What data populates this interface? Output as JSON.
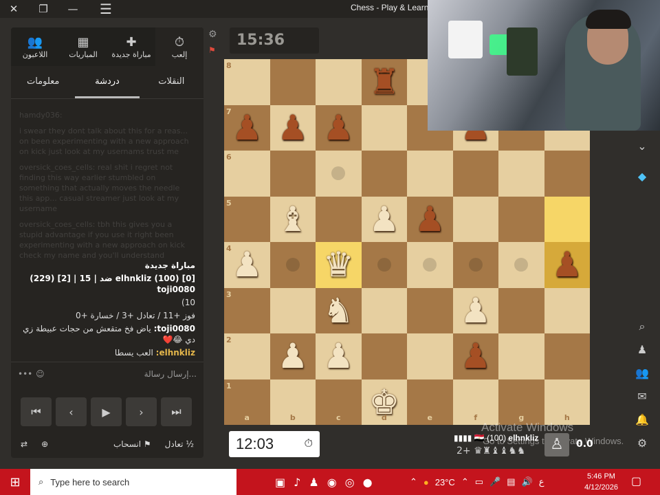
{
  "window": {
    "title": "Chess - Play & Learn -",
    "close": "✕",
    "restore": "❐",
    "minimize": "—",
    "menu": "☰"
  },
  "top_nav": [
    {
      "label": "اللاعبون",
      "icon": "players-icon",
      "glyph": "👥"
    },
    {
      "label": "المباريات",
      "icon": "games-icon",
      "glyph": "▦"
    },
    {
      "label": "مباراة جديدة",
      "icon": "new-game-icon",
      "glyph": "✚"
    },
    {
      "label": "إلعب",
      "icon": "play-clock-icon",
      "glyph": "⏱"
    }
  ],
  "tabs": [
    {
      "label": "معلومات"
    },
    {
      "label": "دردشة"
    },
    {
      "label": "النقلات"
    }
  ],
  "chat": {
    "faded": [
      "hamdy036:",
      "i swear they dont talk about this for a reas... on been experimenting with a new approach on kick just look at my usernams trust me",
      "oversick_coes_cells: real shit i regret not finding this way earlier stumbled on something that actually moves the needle this app... casual streamer just look at my username",
      "oversick_coes_cells: tbh this gives you a stupid advantage if you use it right been experimenting with a new approach on kick check my name and you'll understand"
    ],
    "new_game_title": "مباراة جديدة",
    "match_line": "[0] (100) elhnkliz ضد | 15 | [2] (229) toji0080",
    "match_line2": "10)",
    "result_line": "فوز +11 / تعادل +3 / خسارة +0",
    "msg1_user": "toji0080:",
    "msg1_text": "ياض فخ متقعش من حجات عبيطة زي دي 😂❤️",
    "msg2_user": "elhnkliz:",
    "msg2_text": "العب يسطا",
    "input_placeholder": "إرسال رسالة..."
  },
  "actions": {
    "draw": "تعادل",
    "draw_glyph": "½",
    "resign": "انسحاب",
    "resign_glyph": "⚑"
  },
  "timer_top": "15:36",
  "timer_bottom": "12:03",
  "player": {
    "name": "elhnkliz",
    "rating": "(100)",
    "flag": "🇪🇬",
    "signal": "▮▮▮▮"
  },
  "captured": {
    "count": "2+",
    "pieces": "♛♜♝♝♞♞"
  },
  "eval": "0.0",
  "watermark": {
    "line1": "Activate Windows",
    "line2": "Go to Settings to activate Windows."
  },
  "board": {
    "files": [
      "a",
      "b",
      "c",
      "d",
      "e",
      "f",
      "g",
      "h"
    ],
    "ranks": [
      "8",
      "7",
      "6",
      "5",
      "4",
      "3",
      "2",
      "1"
    ],
    "highlights": [
      "h5",
      "h4",
      "c4"
    ],
    "move_dots": [
      "c6",
      "b4",
      "d4",
      "e4",
      "f4",
      "g4"
    ],
    "pieces": {
      "d8": "br",
      "a7": "bp",
      "b7": "bp",
      "c7": "bp",
      "f7": "bp",
      "b5": "wb",
      "d5": "wp",
      "e5": "bp",
      "a4": "wp",
      "c4": "wq",
      "h4": "bp",
      "c3": "wn",
      "f3": "wp",
      "b2": "wp",
      "c2": "wp",
      "f2": "bp",
      "d1": "wk"
    }
  },
  "taskbar": {
    "search_placeholder": "Type here to search",
    "weather": "23°C",
    "lang": "ع",
    "time": "5:46 PM",
    "date": "4/12/2026"
  },
  "colors": {
    "light_square": "#e6cfa0",
    "dark_square": "#a57847",
    "highlight": "#f6d667",
    "taskbar": "#c4141d"
  }
}
